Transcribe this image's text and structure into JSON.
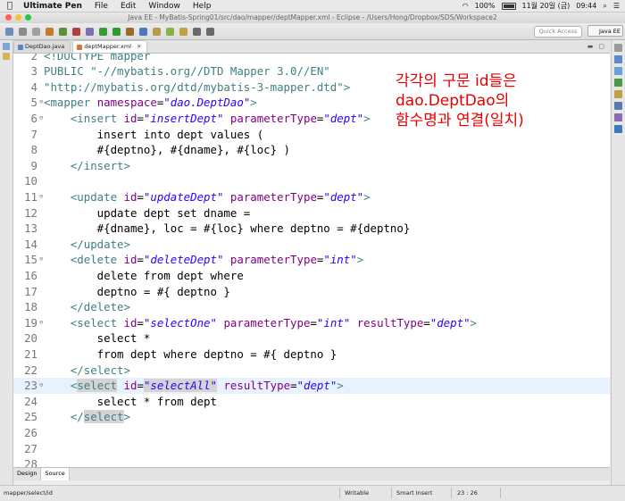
{
  "menubar": {
    "app": "Ultimate Pen",
    "items": [
      "File",
      "Edit",
      "Window",
      "Help"
    ],
    "battery": "100%",
    "date": "11월 20일 (금)",
    "time": "09:44"
  },
  "window": {
    "title": "Java EE - MyBatis-Spring01/src/dao/mapper/deptMapper.xml - Eclipse - /Users/Hong/Dropbox/SDS/Workspace2"
  },
  "toolbar": {
    "quick_access": "Quick Access",
    "perspective": "Java EE"
  },
  "tabs": [
    {
      "label": "DeptDao.java",
      "active": false
    },
    {
      "label": "deptMapper.xml",
      "active": true
    }
  ],
  "editor": {
    "annotation": [
      "각각의 구문 id들은",
      "dao.DeptDao의",
      "함수명과 연결(일치)"
    ],
    "current_line": 23,
    "lines": [
      {
        "num": "2",
        "fold": "",
        "tokens": [
          [
            "tg",
            "<!DOCTYPE mapper"
          ]
        ]
      },
      {
        "num": "3",
        "fold": "",
        "tokens": [
          [
            "tg",
            "PUBLIC \"-//mybatis.org//DTD Mapper 3.0//EN\""
          ]
        ]
      },
      {
        "num": "4",
        "fold": "",
        "tokens": [
          [
            "tg",
            "\"http://mybatis.org/dtd/mybatis-3-mapper.dtd\">"
          ]
        ]
      },
      {
        "num": "5",
        "fold": "⊖",
        "tokens": [
          [
            "tg",
            "<mapper "
          ],
          [
            "at",
            "namespace"
          ],
          [
            "tx",
            "="
          ],
          [
            "vl",
            "\"dao.DeptDao\""
          ],
          [
            "tg",
            ">"
          ]
        ]
      },
      {
        "num": "6",
        "fold": "⊖",
        "tokens": [
          [
            "tx",
            "    "
          ],
          [
            "tg",
            "<insert "
          ],
          [
            "at",
            "id"
          ],
          [
            "tx",
            "="
          ],
          [
            "vl",
            "\"insertDept\""
          ],
          [
            "tx",
            " "
          ],
          [
            "at",
            "parameterType"
          ],
          [
            "tx",
            "="
          ],
          [
            "vl",
            "\"dept\""
          ],
          [
            "tg",
            ">"
          ]
        ]
      },
      {
        "num": "7",
        "fold": "",
        "tokens": [
          [
            "tx",
            "        insert into dept values ("
          ]
        ]
      },
      {
        "num": "8",
        "fold": "",
        "tokens": [
          [
            "tx",
            "        #{deptno}, #{dname}, #{loc} )"
          ]
        ]
      },
      {
        "num": "9",
        "fold": "",
        "tokens": [
          [
            "tx",
            "    "
          ],
          [
            "tg",
            "</insert>"
          ]
        ]
      },
      {
        "num": "10",
        "fold": "",
        "tokens": []
      },
      {
        "num": "11",
        "fold": "⊖",
        "tokens": [
          [
            "tx",
            "    "
          ],
          [
            "tg",
            "<update "
          ],
          [
            "at",
            "id"
          ],
          [
            "tx",
            "="
          ],
          [
            "vl",
            "\"updateDept\""
          ],
          [
            "tx",
            " "
          ],
          [
            "at",
            "parameterType"
          ],
          [
            "tx",
            "="
          ],
          [
            "vl",
            "\"dept\""
          ],
          [
            "tg",
            ">"
          ]
        ]
      },
      {
        "num": "12",
        "fold": "",
        "tokens": [
          [
            "tx",
            "        update dept set dname ="
          ]
        ]
      },
      {
        "num": "13",
        "fold": "",
        "tokens": [
          [
            "tx",
            "        #{dname}, loc = #{loc} where deptno = #{deptno}"
          ]
        ]
      },
      {
        "num": "14",
        "fold": "",
        "tokens": [
          [
            "tx",
            "    "
          ],
          [
            "tg",
            "</update>"
          ]
        ]
      },
      {
        "num": "15",
        "fold": "⊖",
        "tokens": [
          [
            "tx",
            "    "
          ],
          [
            "tg",
            "<delete "
          ],
          [
            "at",
            "id"
          ],
          [
            "tx",
            "="
          ],
          [
            "vl",
            "\"deleteDept\""
          ],
          [
            "tx",
            " "
          ],
          [
            "at",
            "parameterType"
          ],
          [
            "tx",
            "="
          ],
          [
            "vl",
            "\"int\""
          ],
          [
            "tg",
            ">"
          ]
        ]
      },
      {
        "num": "16",
        "fold": "",
        "tokens": [
          [
            "tx",
            "        delete from dept where"
          ]
        ]
      },
      {
        "num": "17",
        "fold": "",
        "tokens": [
          [
            "tx",
            "        deptno = #{ deptno }"
          ]
        ]
      },
      {
        "num": "18",
        "fold": "",
        "tokens": [
          [
            "tx",
            "    "
          ],
          [
            "tg",
            "</delete>"
          ]
        ]
      },
      {
        "num": "19",
        "fold": "⊖",
        "tokens": [
          [
            "tx",
            "    "
          ],
          [
            "tg",
            "<select "
          ],
          [
            "at",
            "id"
          ],
          [
            "tx",
            "="
          ],
          [
            "vl",
            "\"selectOne\""
          ],
          [
            "tx",
            " "
          ],
          [
            "at",
            "parameterType"
          ],
          [
            "tx",
            "="
          ],
          [
            "vl",
            "\"int\""
          ],
          [
            "tx",
            " "
          ],
          [
            "at",
            "resultType"
          ],
          [
            "tx",
            "="
          ],
          [
            "vl",
            "\"dept\""
          ],
          [
            "tg",
            ">"
          ]
        ]
      },
      {
        "num": "20",
        "fold": "",
        "tokens": [
          [
            "tx",
            "        select *"
          ]
        ]
      },
      {
        "num": "21",
        "fold": "",
        "tokens": [
          [
            "tx",
            "        from dept where deptno = #{ deptno }"
          ]
        ]
      },
      {
        "num": "22",
        "fold": "",
        "tokens": [
          [
            "tx",
            "    "
          ],
          [
            "tg",
            "</select>"
          ]
        ]
      },
      {
        "num": "23",
        "fold": "⊖",
        "tokens": [
          [
            "tx",
            "    "
          ],
          [
            "tg",
            "<"
          ],
          [
            "tgsel",
            "select"
          ],
          [
            "tg",
            " "
          ],
          [
            "at",
            "id"
          ],
          [
            "tx",
            "="
          ],
          [
            "vlsel",
            "\"selectAll\""
          ],
          [
            "tx",
            " "
          ],
          [
            "at",
            "resultType"
          ],
          [
            "tx",
            "="
          ],
          [
            "vl",
            "\"dept\""
          ],
          [
            "tg",
            ">"
          ]
        ]
      },
      {
        "num": "24",
        "fold": "",
        "tokens": [
          [
            "tx",
            "        select * from dept"
          ]
        ]
      },
      {
        "num": "25",
        "fold": "",
        "tokens": [
          [
            "tx",
            "    "
          ],
          [
            "tg",
            "</"
          ],
          [
            "tgsel",
            "select"
          ],
          [
            "tg",
            ">"
          ]
        ]
      },
      {
        "num": "26",
        "fold": "",
        "tokens": []
      },
      {
        "num": "27",
        "fold": "",
        "tokens": []
      },
      {
        "num": "28",
        "fold": "",
        "tokens": []
      }
    ]
  },
  "bottom_tabs": [
    {
      "label": "Design",
      "active": false
    },
    {
      "label": "Source",
      "active": true
    }
  ],
  "status": {
    "path": "mapper/select/id",
    "mode": "Writable",
    "insert": "Smart Insert",
    "position": "23 : 26"
  }
}
